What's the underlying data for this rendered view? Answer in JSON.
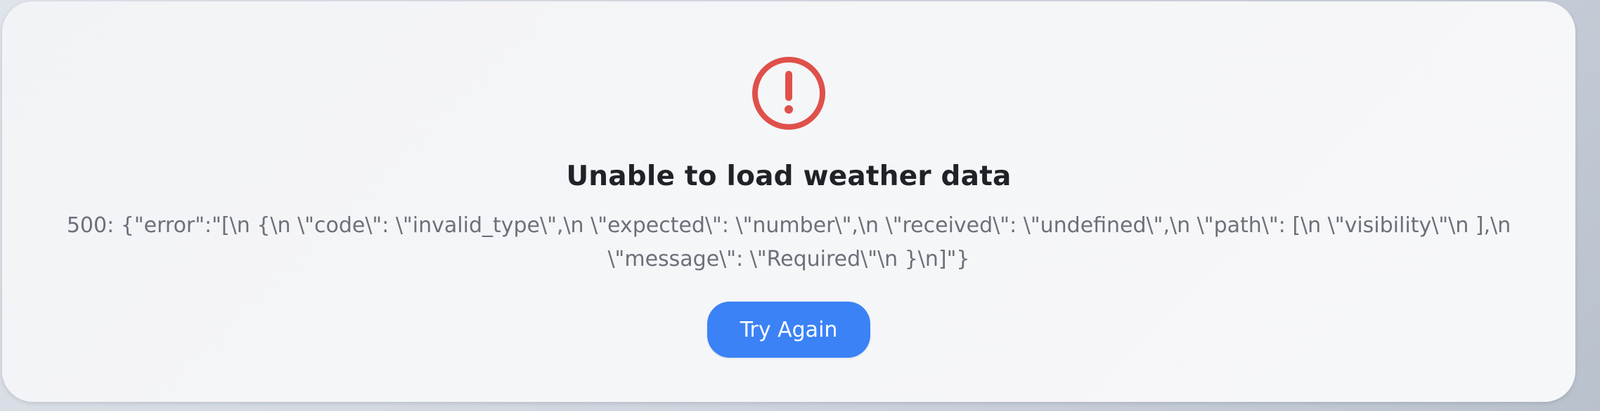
{
  "error_card": {
    "icon": "alert-circle-icon",
    "icon_color": "#e0504b",
    "title": "Unable to load weather data",
    "message": "500: {\"error\":\"[\\n {\\n \\\"code\\\": \\\"invalid_type\\\",\\n \\\"expected\\\": \\\"number\\\",\\n \\\"received\\\": \\\"undefined\\\",\\n \\\"path\\\": [\\n \\\"visibility\\\"\\n ],\\n \\\"message\\\": \\\"Required\\\"\\n }\\n]\"}",
    "retry_label": "Try Again",
    "button_color": "#3b82f6"
  }
}
